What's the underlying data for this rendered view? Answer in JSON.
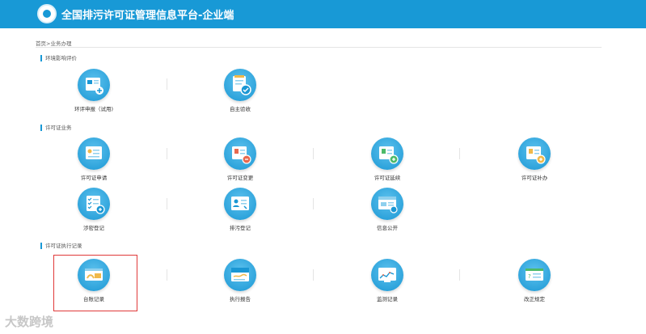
{
  "header": {
    "title": "全国排污许可证管理信息平台-企业端"
  },
  "breadcrumb": "首页>业务办理",
  "sections": [
    {
      "title": "环境影响评价",
      "items": [
        {
          "label": "环评申报（试用)",
          "icon": "eia-report-icon"
        },
        {
          "label": "自主验收",
          "icon": "self-acceptance-icon"
        }
      ]
    },
    {
      "title": "许可证业务",
      "items": [
        {
          "label": "许可证申请",
          "icon": "permit-apply-icon"
        },
        {
          "label": "许可证变更",
          "icon": "permit-change-icon"
        },
        {
          "label": "许可证延续",
          "icon": "permit-renew-icon"
        },
        {
          "label": "许可证补办",
          "icon": "permit-reissue-icon"
        },
        {
          "label": "涉密登记",
          "icon": "confidential-register-icon"
        },
        {
          "label": "排污登记",
          "icon": "discharge-register-icon"
        },
        {
          "label": "信息公开",
          "icon": "info-disclosure-icon"
        }
      ]
    },
    {
      "title": "许可证执行记录",
      "items": [
        {
          "label": "台账记录",
          "icon": "ledger-record-icon"
        },
        {
          "label": "执行报告",
          "icon": "execution-report-icon"
        },
        {
          "label": "监测记录",
          "icon": "monitoring-record-icon"
        },
        {
          "label": "改正规定",
          "icon": "correction-rules-icon"
        }
      ]
    }
  ],
  "watermark": "大数跨境",
  "colors": {
    "header": "#1899d6",
    "icon": "#2aa4de",
    "highlight": "#e03a3a"
  }
}
